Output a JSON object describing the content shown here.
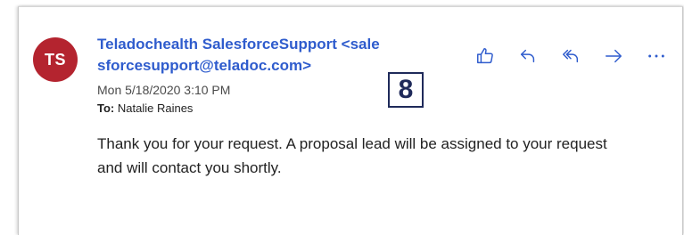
{
  "message": {
    "avatar_initials": "TS",
    "avatar_color": "#b4242f",
    "sender_line1": "Teladochealth SalesforceSupport <sale",
    "sender_line2": "sforcesupport@teladoc.com>",
    "sender_color": "#2f5ccd",
    "date": "Mon 5/18/2020 3:10 PM",
    "to_label": "To:",
    "to_value": "Natalie Raines",
    "body": "Thank you for your request. A proposal lead will be assigned to your request and will contact you shortly."
  },
  "annotation": {
    "badge_number": "8"
  },
  "actions": [
    {
      "icon": "thumbs-up-icon"
    },
    {
      "icon": "reply-icon"
    },
    {
      "icon": "reply-all-icon"
    },
    {
      "icon": "forward-icon"
    },
    {
      "icon": "more-icon"
    }
  ]
}
